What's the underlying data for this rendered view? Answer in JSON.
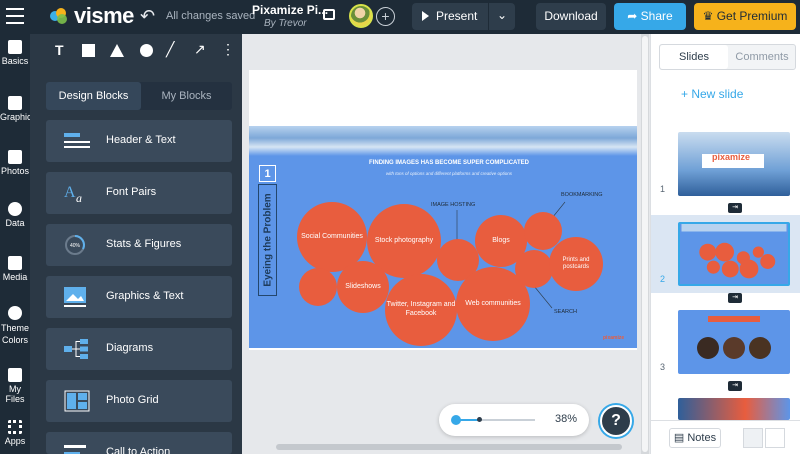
{
  "topbar": {
    "logo": "visme",
    "save_status": "All changes saved",
    "project_title": "Pixamize Pi...",
    "project_author": "By Trevor",
    "present_label": "Present",
    "download_label": "Download",
    "share_label": "Share",
    "premium_label": "Get Premium"
  },
  "rail": {
    "items": [
      {
        "label": "Basics",
        "icon": "basics-icon"
      },
      {
        "label": "Graphics",
        "icon": "graphics-icon"
      },
      {
        "label": "Photos",
        "icon": "photos-icon"
      },
      {
        "label": "Data",
        "icon": "data-icon"
      },
      {
        "label": "Media",
        "icon": "media-icon"
      },
      {
        "label": "Theme Colors",
        "icon": "theme-colors-icon"
      },
      {
        "label": "My Files",
        "icon": "my-files-icon"
      },
      {
        "label": "Apps",
        "icon": "apps-icon"
      }
    ]
  },
  "panel": {
    "tools": [
      "T",
      "rectangle",
      "triangle",
      "circle",
      "line",
      "arrow",
      "more"
    ],
    "tabs": {
      "design": "Design Blocks",
      "mine": "My Blocks"
    },
    "blocks": [
      "Header & Text",
      "Font Pairs",
      "Stats & Figures",
      "Graphics & Text",
      "Diagrams",
      "Photo Grid",
      "Call to Action"
    ],
    "stats_badge": "40%"
  },
  "slide": {
    "number": "1",
    "side_title": "Eyeing the Problem",
    "heading": "FINDING IMAGES HAS BECOME SUPER COMPLICATED",
    "subheading": "with tons of options and different platforms and creative options",
    "bubbles": {
      "social": "Social Communities",
      "stock": "Stock photography",
      "blogs": "Blogs",
      "prints": "Prints and postcards",
      "slideshows": "Slideshows",
      "twitter": "Twitter, Instagram and Facebook",
      "web": "Web communities"
    },
    "labels": {
      "image_hosting": "IMAGE HOSTING",
      "bookmarking": "BOOKMARKING",
      "search": "SEARCH"
    },
    "logo": "pixamize"
  },
  "zoom": {
    "value": "38%",
    "level": 0.38
  },
  "help": "?",
  "right_panel": {
    "tabs": {
      "slides": "Slides",
      "comments": "Comments"
    },
    "new_slide": "+ New slide",
    "thumb_numbers": [
      "1",
      "2",
      "3"
    ],
    "thumb1_logo": "pixamize",
    "notes_label": "Notes"
  },
  "colors": {
    "topbar": "#1e2b37",
    "accent_blue": "#36a8e8",
    "premium": "#f6b21b",
    "bubble": "#e85d3e",
    "slide_bg": "#5d95e8"
  }
}
